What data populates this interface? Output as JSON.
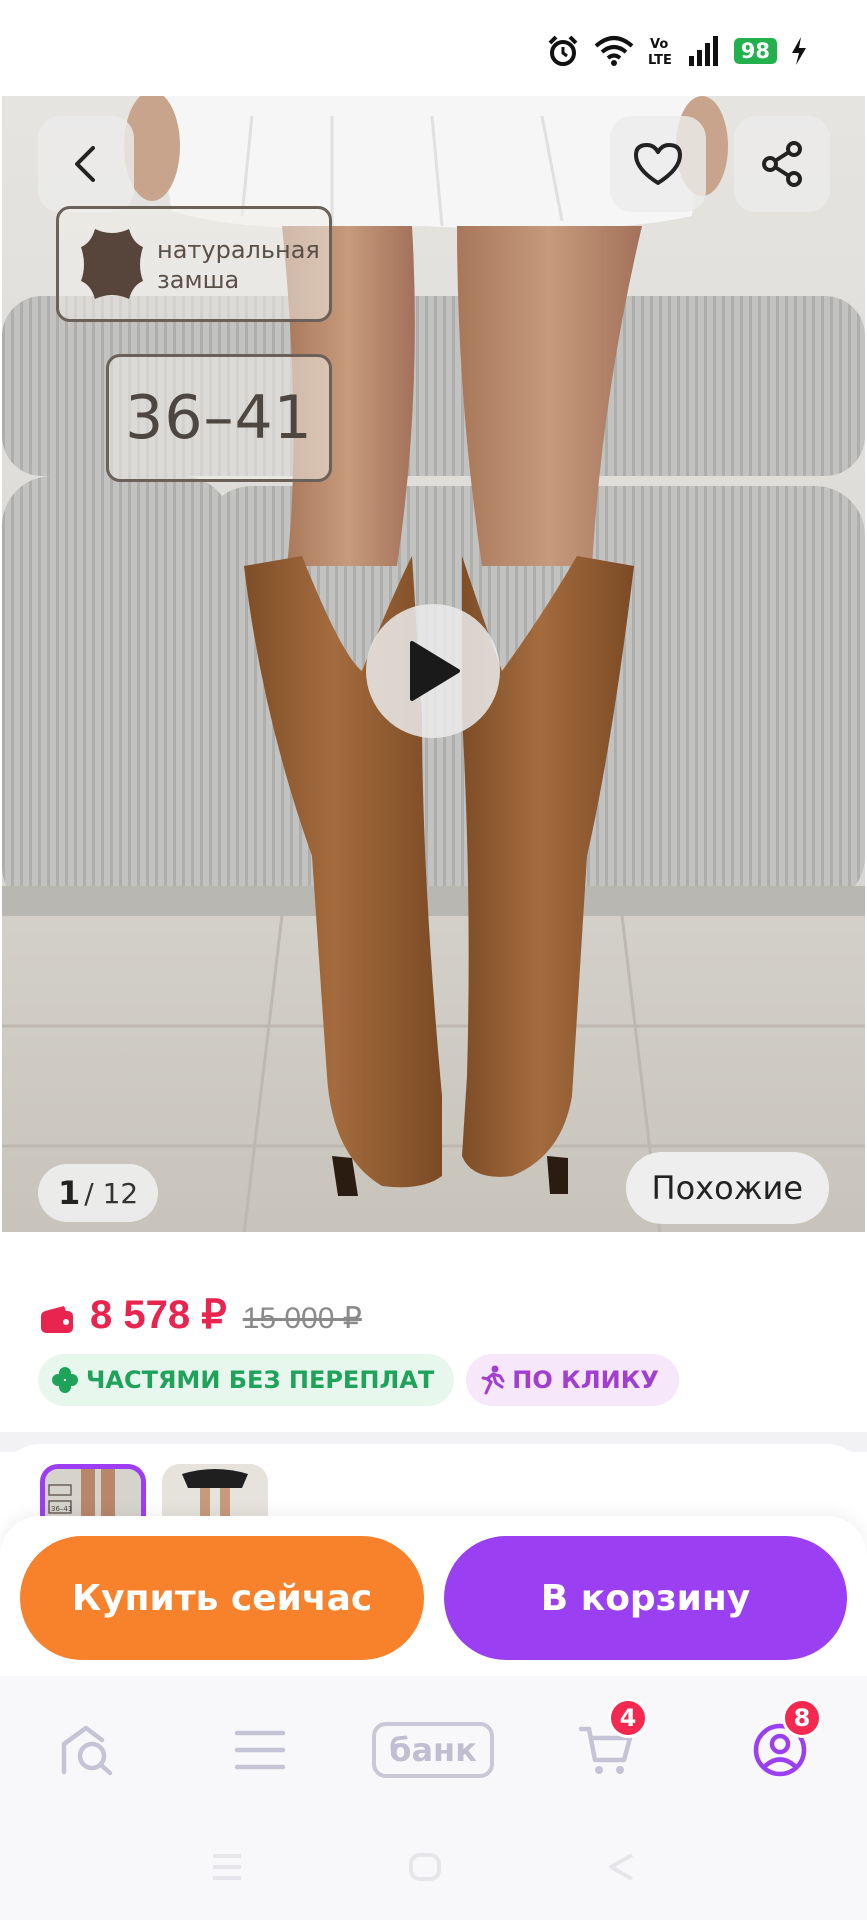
{
  "status_bar": {
    "battery": "98",
    "icons": [
      "alarm-icon",
      "wifi-icon",
      "volte-icon",
      "signal-icon",
      "charging-icon"
    ],
    "volte_label": "Vo\nLTE"
  },
  "hero": {
    "features": {
      "material": "натуральная замша",
      "sizes": "36–41"
    },
    "counter_current": "1",
    "counter_total": "/ 12",
    "similar_label": "Похожие"
  },
  "price": {
    "current": "8 578 ₽",
    "old": "15 000 ₽",
    "colors": {
      "price": "#e8244f",
      "old": "#8a8a8a"
    }
  },
  "badges": [
    {
      "label": "ЧАСТЯМИ БЕЗ ПЕРЕПЛАТ",
      "color": "#1fa35b"
    },
    {
      "label": "ПО КЛИКУ",
      "color": "#a13fd0"
    }
  ],
  "thumbs": {
    "thumb1_text": "36–41"
  },
  "actions": {
    "buy_label": "Купить сейчас",
    "cart_label": "В корзину",
    "colors": {
      "buy": "#f8812b",
      "cart": "#9b3ff3"
    }
  },
  "tabbar": {
    "items": [
      {
        "name": "home",
        "icon": "home-search-icon"
      },
      {
        "name": "catalog",
        "icon": "menu-icon"
      },
      {
        "name": "bank",
        "label": "банк"
      },
      {
        "name": "cart",
        "icon": "cart-icon",
        "badge": "4"
      },
      {
        "name": "profile",
        "icon": "profile-icon",
        "badge": "8"
      }
    ]
  }
}
